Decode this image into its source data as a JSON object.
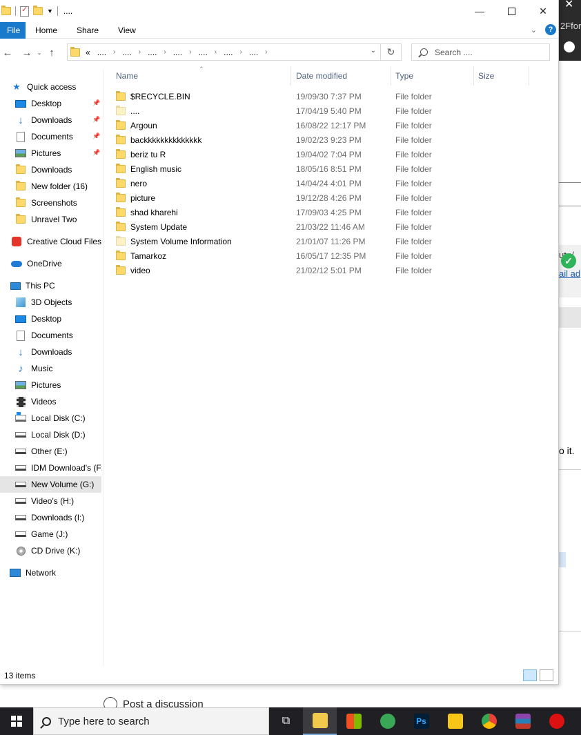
{
  "background": {
    "tab_fragment": "2Ffor",
    "link_fragment": "ail ad",
    "text_fragment": "ut :/",
    "do_it_fragment": "o it.",
    "post_discussion": "Post a discussion"
  },
  "window": {
    "title": "....",
    "ribbon_tabs": [
      "File",
      "Home",
      "Share",
      "View"
    ],
    "help": "?"
  },
  "address": {
    "prefix": "«",
    "crumbs": [
      "....",
      "....",
      "....",
      "....",
      "....",
      "....",
      "...."
    ],
    "search_placeholder": "Search ...."
  },
  "nav": {
    "quick_access": "Quick access",
    "quick_items": [
      "Desktop",
      "Downloads",
      "Documents",
      "Pictures",
      "Downloads",
      "New folder (16)",
      "Screenshots",
      "Unravel Two"
    ],
    "creative_cloud": "Creative Cloud Files",
    "onedrive": "OneDrive",
    "this_pc": "This PC",
    "pc_items": [
      "3D Objects",
      "Desktop",
      "Documents",
      "Downloads",
      "Music",
      "Pictures",
      "Videos",
      "Local Disk (C:)",
      "Local Disk (D:)",
      "Other (E:)",
      "IDM Download's (F:",
      "New Volume (G:)",
      "Video's (H:)",
      "Downloads (I:)",
      "Game (J:)",
      "CD Drive (K:)"
    ],
    "network": "Network",
    "selected": "New Volume (G:)"
  },
  "columns": {
    "name": "Name",
    "date": "Date modified",
    "type": "Type",
    "size": "Size"
  },
  "files": [
    {
      "name": "$RECYCLE.BIN",
      "date": "19/09/30 7:37 PM",
      "type": "File folder",
      "faded": false
    },
    {
      "name": "....",
      "date": "17/04/19 5:40 PM",
      "type": "File folder",
      "faded": true
    },
    {
      "name": "Argoun",
      "date": "16/08/22 12:17 PM",
      "type": "File folder",
      "faded": false
    },
    {
      "name": "backkkkkkkkkkkkkk",
      "date": "19/02/23 9:23 PM",
      "type": "File folder",
      "faded": false
    },
    {
      "name": "beriz tu R",
      "date": "19/04/02 7:04 PM",
      "type": "File folder",
      "faded": false
    },
    {
      "name": "English music",
      "date": "18/05/16 8:51 PM",
      "type": "File folder",
      "faded": false
    },
    {
      "name": "nero",
      "date": "14/04/24 4:01 PM",
      "type": "File folder",
      "faded": false
    },
    {
      "name": "picture",
      "date": "19/12/28 4:26 PM",
      "type": "File folder",
      "faded": false
    },
    {
      "name": "shad kharehi",
      "date": "17/09/03 4:25 PM",
      "type": "File folder",
      "faded": false
    },
    {
      "name": "System Update",
      "date": "21/03/22 11:46 AM",
      "type": "File folder",
      "faded": false
    },
    {
      "name": "System Volume Information",
      "date": "21/01/07 11:26 PM",
      "type": "File folder",
      "faded": true
    },
    {
      "name": "Tamarkoz",
      "date": "16/05/17 12:35 PM",
      "type": "File folder",
      "faded": false
    },
    {
      "name": "video",
      "date": "21/02/12 5:01 PM",
      "type": "File folder",
      "faded": false
    }
  ],
  "status": {
    "count": "13 items"
  },
  "taskbar": {
    "search_placeholder": "Type here to search",
    "apps": [
      "task-view",
      "file-explorer",
      "microsoft-store",
      "telegram",
      "photoshop",
      "media-player",
      "chrome",
      "winrar",
      "app-red"
    ]
  }
}
